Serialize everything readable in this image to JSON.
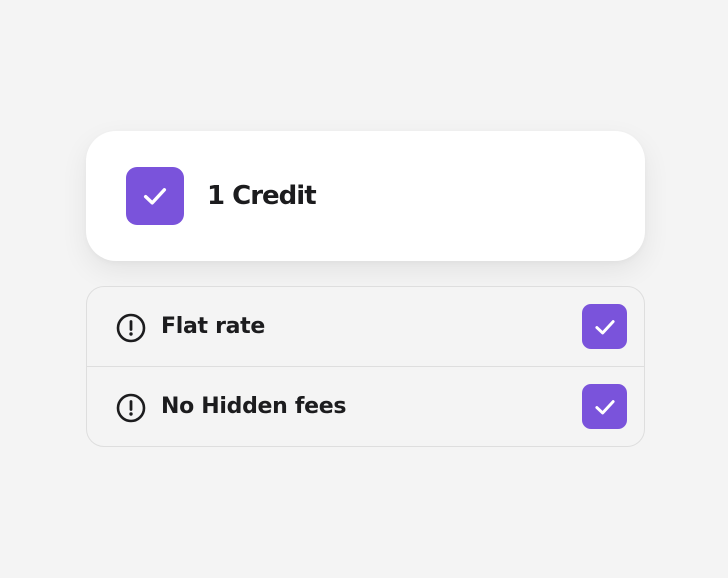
{
  "accent_color": "#7a53db",
  "credit_option": {
    "label": "1 Credit",
    "checked": true,
    "check_icon": "checkmark-icon"
  },
  "features": [
    {
      "label": "Flat rate",
      "icon": "exclamation-circle-icon",
      "checked": true
    },
    {
      "label": "No Hidden fees",
      "icon": "exclamation-circle-icon",
      "checked": true
    }
  ]
}
